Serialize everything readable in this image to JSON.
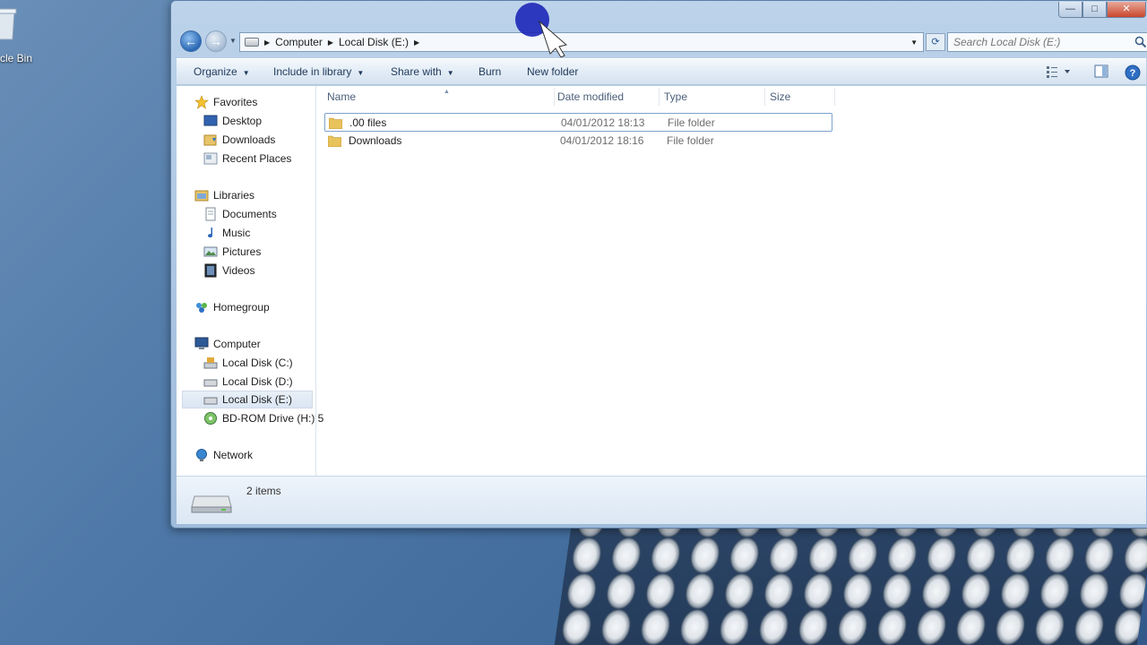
{
  "desktop": {
    "recycle_bin_label": "cle Bin"
  },
  "window": {
    "controls": {
      "minimize": "—",
      "maximize": "□",
      "close": "✕"
    },
    "address": {
      "crumbs": [
        "Computer",
        "Local Disk (E:)"
      ]
    },
    "search": {
      "placeholder": "Search Local Disk (E:)"
    },
    "toolbar": {
      "organize": "Organize",
      "include_in_library": "Include in library",
      "share_with": "Share with",
      "burn": "Burn",
      "new_folder": "New folder"
    },
    "sidebar": {
      "favorites": "Favorites",
      "desktop": "Desktop",
      "downloads": "Downloads",
      "recent_places": "Recent Places",
      "libraries": "Libraries",
      "documents": "Documents",
      "music": "Music",
      "pictures": "Pictures",
      "videos": "Videos",
      "homegroup": "Homegroup",
      "computer": "Computer",
      "disk_c": "Local Disk (C:)",
      "disk_d": "Local Disk (D:)",
      "disk_e": "Local Disk (E:)",
      "bd_rom": "BD-ROM Drive (H:) 5",
      "network": "Network"
    },
    "columns": {
      "name": "Name",
      "date_modified": "Date modified",
      "type": "Type",
      "size": "Size"
    },
    "files": [
      {
        "name": ".00 files",
        "date": "04/01/2012 18:13",
        "type": "File folder"
      },
      {
        "name": "Downloads",
        "date": "04/01/2012 18:16",
        "type": "File folder"
      }
    ],
    "details": {
      "item_count": "2 items"
    }
  },
  "colors": {
    "window_frame": "#a9c4e0",
    "toolbar_text": "#1e395b",
    "selection_border": "#7da2ce"
  }
}
